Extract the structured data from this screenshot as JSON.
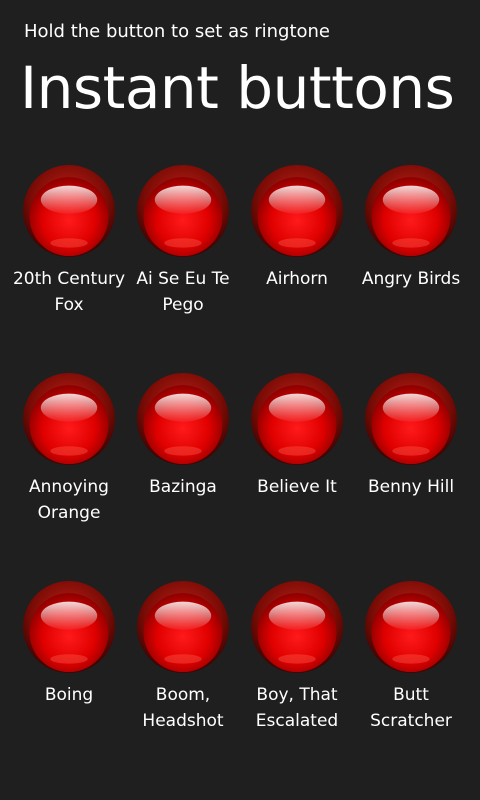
{
  "header": {
    "subtitle": "Hold the button to set as ringtone",
    "title": "Instant buttons"
  },
  "colors": {
    "background": "#1f1f1f",
    "button_red": "#e00000",
    "button_rim": "#7a0b05",
    "text": "#ffffff"
  },
  "button_icon": "red-push-button-icon",
  "buttons": [
    {
      "label": "20th Century Fox"
    },
    {
      "label": "Ai Se Eu Te Pego"
    },
    {
      "label": "Airhorn"
    },
    {
      "label": "Angry Birds"
    },
    {
      "label": "Annoying Orange"
    },
    {
      "label": "Bazinga"
    },
    {
      "label": "Believe It"
    },
    {
      "label": "Benny Hill"
    },
    {
      "label": "Boing"
    },
    {
      "label": "Boom, Headshot"
    },
    {
      "label": "Boy, That Escalated"
    },
    {
      "label": "Butt Scratcher"
    }
  ]
}
